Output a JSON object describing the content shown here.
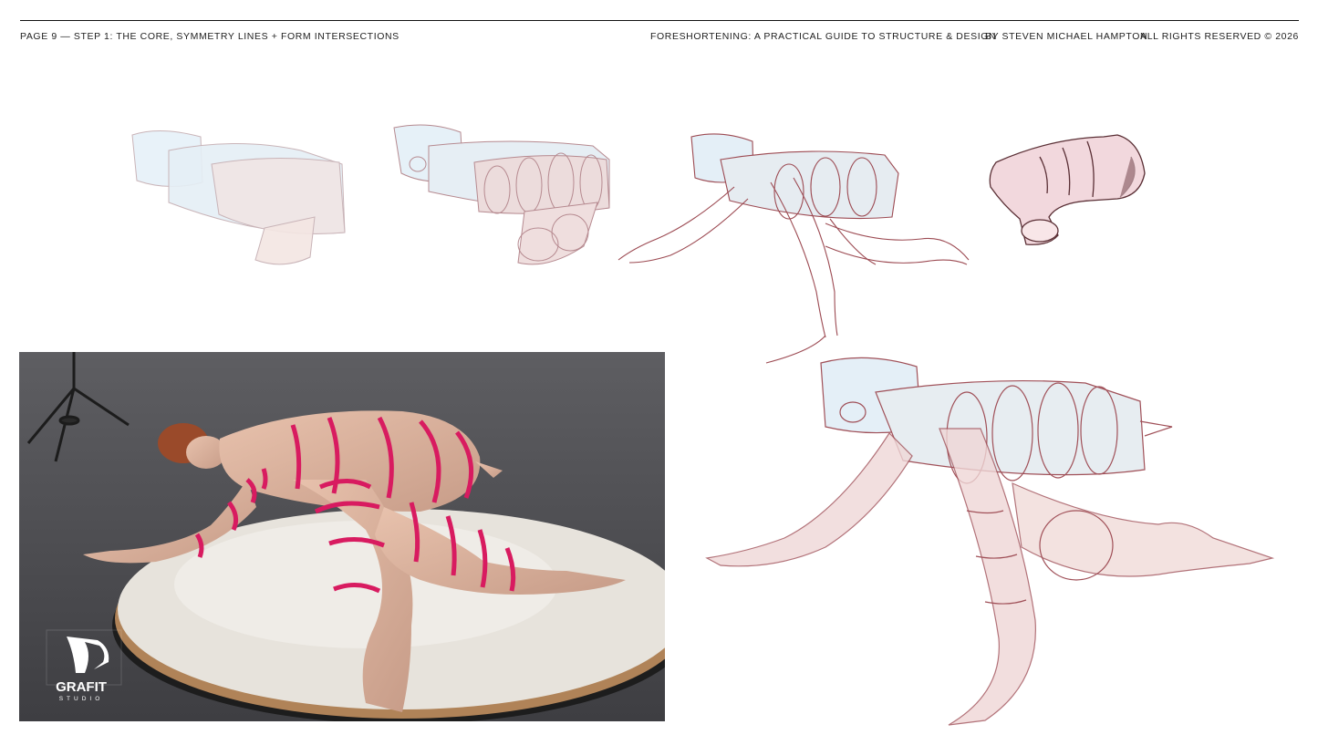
{
  "header": {
    "page_info": "PAGE 9 — STEP 1: THE CORE, SYMMETRY LINES + FORM INTERSECTIONS",
    "book_title": "FORESHORTENING: A PRACTICAL GUIDE TO STRUCTURE & DESIGN",
    "author": "BY STEVEN MICHAEL HAMPTON",
    "rights": "ALL RIGHTS RESERVED © 2026"
  },
  "photo": {
    "logo_text": "GRAFIT",
    "logo_subtext": "STUDIO",
    "tape_color": "#d81b60"
  },
  "colors": {
    "sketch_line": "#9c4a52",
    "blue_fill": "#dcebf5",
    "pink_fill": "#efd3d3"
  }
}
